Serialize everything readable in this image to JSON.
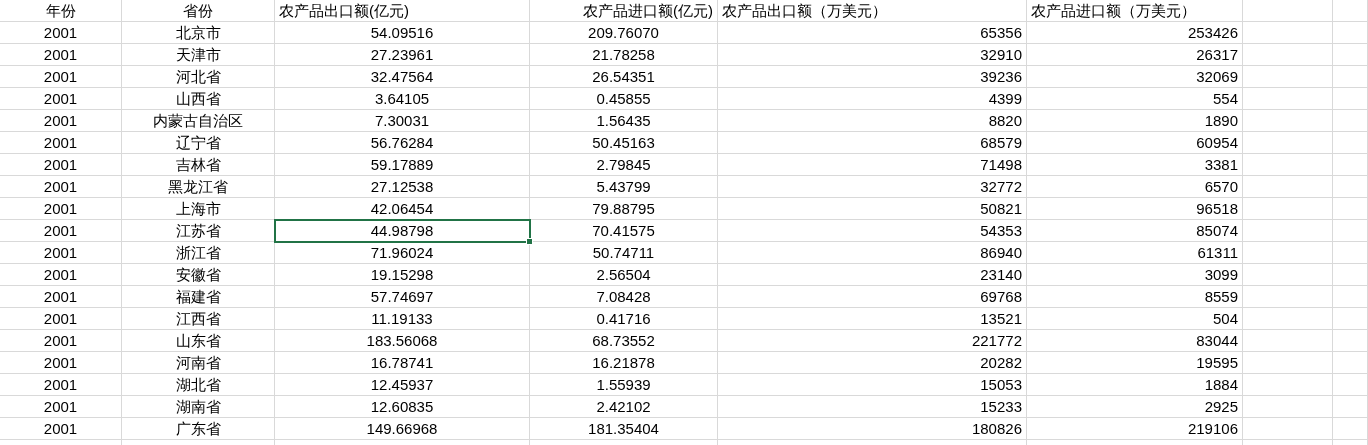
{
  "columns": [
    {
      "label": "年份"
    },
    {
      "label": "省份"
    },
    {
      "label": "农产品出口额(亿元)"
    },
    {
      "label": "农产品进口额(亿元)"
    },
    {
      "label": "农产品出口额（万美元）"
    },
    {
      "label": "农产品进口额（万美元）"
    }
  ],
  "rows": [
    {
      "cells": [
        {
          "text": "2001",
          "selected": false
        },
        {
          "text": "北京市",
          "selected": false
        },
        {
          "text": "54.09516",
          "selected": false
        },
        {
          "text": "209.76070",
          "selected": false
        },
        {
          "text": "65356",
          "selected": false
        },
        {
          "text": "253426",
          "selected": false
        }
      ]
    },
    {
      "cells": [
        {
          "text": "2001",
          "selected": false
        },
        {
          "text": "天津市",
          "selected": false
        },
        {
          "text": "27.23961",
          "selected": false
        },
        {
          "text": "21.78258",
          "selected": false
        },
        {
          "text": "32910",
          "selected": false
        },
        {
          "text": "26317",
          "selected": false
        }
      ]
    },
    {
      "cells": [
        {
          "text": "2001",
          "selected": false
        },
        {
          "text": "河北省",
          "selected": false
        },
        {
          "text": "32.47564",
          "selected": false
        },
        {
          "text": "26.54351",
          "selected": false
        },
        {
          "text": "39236",
          "selected": false
        },
        {
          "text": "32069",
          "selected": false
        }
      ]
    },
    {
      "cells": [
        {
          "text": "2001",
          "selected": false
        },
        {
          "text": "山西省",
          "selected": false
        },
        {
          "text": "3.64105",
          "selected": false
        },
        {
          "text": "0.45855",
          "selected": false
        },
        {
          "text": "4399",
          "selected": false
        },
        {
          "text": "554",
          "selected": false
        }
      ]
    },
    {
      "cells": [
        {
          "text": "2001",
          "selected": false
        },
        {
          "text": "内蒙古自治区",
          "selected": false
        },
        {
          "text": "7.30031",
          "selected": false
        },
        {
          "text": "1.56435",
          "selected": false
        },
        {
          "text": "8820",
          "selected": false
        },
        {
          "text": "1890",
          "selected": false
        }
      ]
    },
    {
      "cells": [
        {
          "text": "2001",
          "selected": false
        },
        {
          "text": "辽宁省",
          "selected": false
        },
        {
          "text": "56.76284",
          "selected": false
        },
        {
          "text": "50.45163",
          "selected": false
        },
        {
          "text": "68579",
          "selected": false
        },
        {
          "text": "60954",
          "selected": false
        }
      ]
    },
    {
      "cells": [
        {
          "text": "2001",
          "selected": false
        },
        {
          "text": "吉林省",
          "selected": false
        },
        {
          "text": "59.17889",
          "selected": false
        },
        {
          "text": "2.79845",
          "selected": false
        },
        {
          "text": "71498",
          "selected": false
        },
        {
          "text": "3381",
          "selected": false
        }
      ]
    },
    {
      "cells": [
        {
          "text": "2001",
          "selected": false
        },
        {
          "text": "黑龙江省",
          "selected": false
        },
        {
          "text": "27.12538",
          "selected": false
        },
        {
          "text": "5.43799",
          "selected": false
        },
        {
          "text": "32772",
          "selected": false
        },
        {
          "text": "6570",
          "selected": false
        }
      ]
    },
    {
      "cells": [
        {
          "text": "2001",
          "selected": false
        },
        {
          "text": "上海市",
          "selected": false
        },
        {
          "text": "42.06454",
          "selected": false
        },
        {
          "text": "79.88795",
          "selected": false
        },
        {
          "text": "50821",
          "selected": false
        },
        {
          "text": "96518",
          "selected": false
        }
      ]
    },
    {
      "cells": [
        {
          "text": "2001",
          "selected": false
        },
        {
          "text": "江苏省",
          "selected": false
        },
        {
          "text": "44.98798",
          "selected": true
        },
        {
          "text": "70.41575",
          "selected": false
        },
        {
          "text": "54353",
          "selected": false
        },
        {
          "text": "85074",
          "selected": false
        }
      ]
    },
    {
      "cells": [
        {
          "text": "2001",
          "selected": false
        },
        {
          "text": "浙江省",
          "selected": false
        },
        {
          "text": "71.96024",
          "selected": false
        },
        {
          "text": "50.74711",
          "selected": false
        },
        {
          "text": "86940",
          "selected": false
        },
        {
          "text": "61311",
          "selected": false
        }
      ]
    },
    {
      "cells": [
        {
          "text": "2001",
          "selected": false
        },
        {
          "text": "安徽省",
          "selected": false
        },
        {
          "text": "19.15298",
          "selected": false
        },
        {
          "text": "2.56504",
          "selected": false
        },
        {
          "text": "23140",
          "selected": false
        },
        {
          "text": "3099",
          "selected": false
        }
      ]
    },
    {
      "cells": [
        {
          "text": "2001",
          "selected": false
        },
        {
          "text": "福建省",
          "selected": false
        },
        {
          "text": "57.74697",
          "selected": false
        },
        {
          "text": "7.08428",
          "selected": false
        },
        {
          "text": "69768",
          "selected": false
        },
        {
          "text": "8559",
          "selected": false
        }
      ]
    },
    {
      "cells": [
        {
          "text": "2001",
          "selected": false
        },
        {
          "text": "江西省",
          "selected": false
        },
        {
          "text": "11.19133",
          "selected": false
        },
        {
          "text": "0.41716",
          "selected": false
        },
        {
          "text": "13521",
          "selected": false
        },
        {
          "text": "504",
          "selected": false
        }
      ]
    },
    {
      "cells": [
        {
          "text": "2001",
          "selected": false
        },
        {
          "text": "山东省",
          "selected": false
        },
        {
          "text": "183.56068",
          "selected": false
        },
        {
          "text": "68.73552",
          "selected": false
        },
        {
          "text": "221772",
          "selected": false
        },
        {
          "text": "83044",
          "selected": false
        }
      ]
    },
    {
      "cells": [
        {
          "text": "2001",
          "selected": false
        },
        {
          "text": "河南省",
          "selected": false
        },
        {
          "text": "16.78741",
          "selected": false
        },
        {
          "text": "16.21878",
          "selected": false
        },
        {
          "text": "20282",
          "selected": false
        },
        {
          "text": "19595",
          "selected": false
        }
      ]
    },
    {
      "cells": [
        {
          "text": "2001",
          "selected": false
        },
        {
          "text": "湖北省",
          "selected": false
        },
        {
          "text": "12.45937",
          "selected": false
        },
        {
          "text": "1.55939",
          "selected": false
        },
        {
          "text": "15053",
          "selected": false
        },
        {
          "text": "1884",
          "selected": false
        }
      ]
    },
    {
      "cells": [
        {
          "text": "2001",
          "selected": false
        },
        {
          "text": "湖南省",
          "selected": false
        },
        {
          "text": "12.60835",
          "selected": false
        },
        {
          "text": "2.42102",
          "selected": false
        },
        {
          "text": "15233",
          "selected": false
        },
        {
          "text": "2925",
          "selected": false
        }
      ]
    },
    {
      "cells": [
        {
          "text": "2001",
          "selected": false
        },
        {
          "text": "广东省",
          "selected": false
        },
        {
          "text": "149.66968",
          "selected": false
        },
        {
          "text": "181.35404",
          "selected": false
        },
        {
          "text": "180826",
          "selected": false
        },
        {
          "text": "219106",
          "selected": false
        }
      ]
    }
  ]
}
